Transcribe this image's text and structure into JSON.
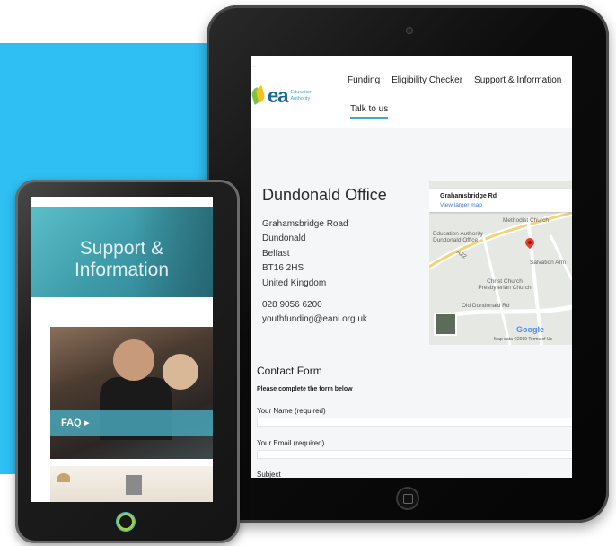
{
  "ipad": {
    "top_bar": "...",
    "logo_text": "ea",
    "logo_sub": "Education Authority",
    "nav": [
      "Funding",
      "Eligibility Checker",
      "Support & Information"
    ],
    "nav_sub": "...",
    "talk_label": "Talk to us",
    "office": {
      "title": "Dundonald Office",
      "address": [
        "Grahamsbridge Road",
        "Dundonald",
        "Belfast",
        "BT16 2HS",
        "United Kingdom"
      ],
      "phone": "028 9056 6200",
      "email": "youthfunding@eani.org.uk"
    },
    "map": {
      "place_title": "Grahamsbridge Rd",
      "larger_map_link": "View larger map",
      "labels": [
        "Methodist Church",
        "Education Authority Dundonald Office",
        "A22",
        "Salvation Arm",
        "Christ Church Presbyterian Church",
        "Old Dundonald Rd"
      ],
      "google": "Google",
      "footer": "Map data ©2019   Terms of Us"
    },
    "contact_form": {
      "title": "Contact Form",
      "instruction": "Please complete the form below",
      "fields": [
        "Your Name (required)",
        "Your Email (required)",
        "Subject"
      ]
    }
  },
  "tablet": {
    "hero_title": "Support & Information",
    "faq_label": "FAQ ▸"
  },
  "colors": {
    "bg_accent": "#2fbff3",
    "link": "#3b78d8",
    "pin": "#e33b2e",
    "teal": "#3d9aa8"
  }
}
